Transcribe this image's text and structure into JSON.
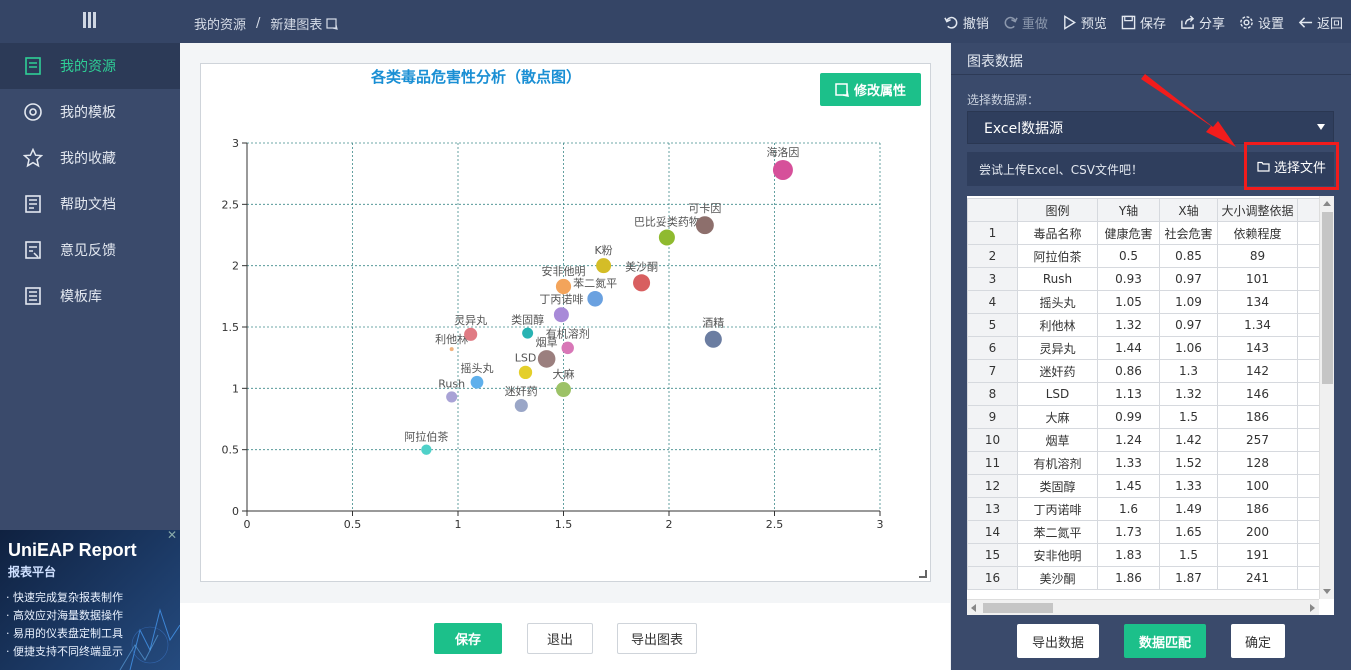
{
  "breadcrumb": {
    "root": "我的资源",
    "current": "新建图表"
  },
  "toolbar": [
    {
      "name": "undo",
      "label": "撤销",
      "icon": "undo-icon",
      "enabled": true
    },
    {
      "name": "redo",
      "label": "重做",
      "icon": "redo-icon",
      "enabled": false
    },
    {
      "name": "preview",
      "label": "预览",
      "icon": "play-icon",
      "enabled": true
    },
    {
      "name": "save",
      "label": "保存",
      "icon": "save-icon",
      "enabled": true
    },
    {
      "name": "share",
      "label": "分享",
      "icon": "share-icon",
      "enabled": true
    },
    {
      "name": "settings",
      "label": "设置",
      "icon": "gear-icon",
      "enabled": true
    },
    {
      "name": "back",
      "label": "返回",
      "icon": "arrow-left-icon",
      "enabled": true
    }
  ],
  "sidebar": {
    "items": [
      {
        "label": "我的资源",
        "icon": "file-icon",
        "active": true
      },
      {
        "label": "我的模板",
        "icon": "target-icon",
        "active": false
      },
      {
        "label": "我的收藏",
        "icon": "star-icon",
        "active": false
      },
      {
        "label": "帮助文档",
        "icon": "doc-icon",
        "active": false
      },
      {
        "label": "意见反馈",
        "icon": "feedback-icon",
        "active": false
      },
      {
        "label": "模板库",
        "icon": "library-icon",
        "active": false
      }
    ],
    "ad": {
      "title": "UniEAP Report",
      "subtitle": "报表平台",
      "features": [
        "快速完成复杂报表制作",
        "高效应对海量数据操作",
        "易用的仪表盘定制工具",
        "便捷支持不同终端显示"
      ]
    }
  },
  "chart_panel": {
    "modify_label": "修改属性"
  },
  "chart_data": {
    "type": "scatter",
    "title": "各类毒品危害性分析（散点图）",
    "xlabel": "",
    "ylabel": "",
    "xlim": [
      0,
      3
    ],
    "ylim": [
      0,
      3
    ],
    "xticks": [
      0,
      0.5,
      1,
      1.5,
      2,
      2.5,
      3
    ],
    "yticks": [
      0,
      0.5,
      1,
      1.5,
      2,
      2.5,
      3
    ],
    "xtick_labels": [
      "0",
      "0.5",
      "1",
      "1.5",
      "2",
      "2.5",
      "3"
    ],
    "ytick_labels": [
      "0",
      "0.5",
      "1",
      "1.5",
      "2",
      "2.5",
      "3"
    ],
    "grid": true,
    "points": [
      {
        "name": "阿拉伯茶",
        "x": 0.85,
        "y": 0.5,
        "size": 89,
        "color": "#4fd1c9"
      },
      {
        "name": "Rush",
        "x": 0.97,
        "y": 0.93,
        "size": 101,
        "color": "#a9a3d6"
      },
      {
        "name": "摇头丸",
        "x": 1.09,
        "y": 1.05,
        "size": 134,
        "color": "#5fb0ec"
      },
      {
        "name": "利他林",
        "x": 0.97,
        "y": 1.32,
        "size": 1.34,
        "color": "#f0b37e"
      },
      {
        "name": "灵异丸",
        "x": 1.06,
        "y": 1.44,
        "size": 143,
        "color": "#e07b84"
      },
      {
        "name": "迷奸药",
        "x": 1.3,
        "y": 0.86,
        "size": 142,
        "color": "#9aa6c7"
      },
      {
        "name": "LSD",
        "x": 1.32,
        "y": 1.13,
        "size": 146,
        "color": "#e4cf2a"
      },
      {
        "name": "大麻",
        "x": 1.5,
        "y": 0.99,
        "size": 186,
        "color": "#9cc267"
      },
      {
        "name": "烟草",
        "x": 1.42,
        "y": 1.24,
        "size": 257,
        "color": "#9b7f7e"
      },
      {
        "name": "有机溶剂",
        "x": 1.52,
        "y": 1.33,
        "size": 128,
        "color": "#d877b7"
      },
      {
        "name": "类固醇",
        "x": 1.33,
        "y": 1.45,
        "size": 100,
        "color": "#28b3b3"
      },
      {
        "name": "丁丙诺啡",
        "x": 1.49,
        "y": 1.6,
        "size": 186,
        "color": "#a88ad8"
      },
      {
        "name": "苯二氮平",
        "x": 1.65,
        "y": 1.73,
        "size": 200,
        "color": "#6aa1e0"
      },
      {
        "name": "安非他明",
        "x": 1.5,
        "y": 1.83,
        "size": 191,
        "color": "#f3a45b"
      },
      {
        "name": "美沙酮",
        "x": 1.87,
        "y": 1.86,
        "size": 241,
        "color": "#d85f60"
      },
      {
        "name": "K粉",
        "x": 1.69,
        "y": 2.0,
        "size": 186,
        "color": "#d4bd27"
      },
      {
        "name": "酒精",
        "x": 2.21,
        "y": 1.4,
        "size": 241,
        "color": "#6b7da1"
      },
      {
        "name": "巴比妥类药物",
        "x": 1.99,
        "y": 2.23,
        "size": 212,
        "color": "#8fba2f"
      },
      {
        "name": "可卡因",
        "x": 2.17,
        "y": 2.33,
        "size": 265,
        "color": "#8d6f6c"
      },
      {
        "name": "海洛因",
        "x": 2.54,
        "y": 2.78,
        "size": 330,
        "color": "#d6509a"
      }
    ]
  },
  "bottom_buttons": {
    "save": "保存",
    "exit": "退出",
    "export": "导出图表"
  },
  "right_panel": {
    "title": "图表数据",
    "source_label": "选择数据源：",
    "source_value": "Excel数据源",
    "upload_hint": "尝试上传Excel、CSV文件吧！",
    "file_button": "选择文件",
    "table": {
      "columns": [
        "图例",
        "Y轴",
        "X轴",
        "大小调整依据"
      ],
      "rows": [
        [
          "1",
          "毒品名称",
          "健康危害",
          "社会危害",
          "依赖程度"
        ],
        [
          "2",
          "阿拉伯茶",
          "0.5",
          "0.85",
          "89"
        ],
        [
          "3",
          "Rush",
          "0.93",
          "0.97",
          "101"
        ],
        [
          "4",
          "摇头丸",
          "1.05",
          "1.09",
          "134"
        ],
        [
          "5",
          "利他林",
          "1.32",
          "0.97",
          "1.34"
        ],
        [
          "6",
          "灵异丸",
          "1.44",
          "1.06",
          "143"
        ],
        [
          "7",
          "迷奸药",
          "0.86",
          "1.3",
          "142"
        ],
        [
          "8",
          "LSD",
          "1.13",
          "1.32",
          "146"
        ],
        [
          "9",
          "大麻",
          "0.99",
          "1.5",
          "186"
        ],
        [
          "10",
          "烟草",
          "1.24",
          "1.42",
          "257"
        ],
        [
          "11",
          "有机溶剂",
          "1.33",
          "1.52",
          "128"
        ],
        [
          "12",
          "类固醇",
          "1.45",
          "1.33",
          "100"
        ],
        [
          "13",
          "丁丙诺啡",
          "1.6",
          "1.49",
          "186"
        ],
        [
          "14",
          "苯二氮平",
          "1.73",
          "1.65",
          "200"
        ],
        [
          "15",
          "安非他明",
          "1.83",
          "1.5",
          "191"
        ],
        [
          "16",
          "美沙酮",
          "1.86",
          "1.87",
          "241"
        ]
      ]
    },
    "buttons": {
      "export": "导出数据",
      "match": "数据匹配",
      "ok": "确定"
    }
  },
  "colors": {
    "accent": "#1cc08a",
    "nav": "#354566",
    "highlight": "#f21c1c"
  }
}
